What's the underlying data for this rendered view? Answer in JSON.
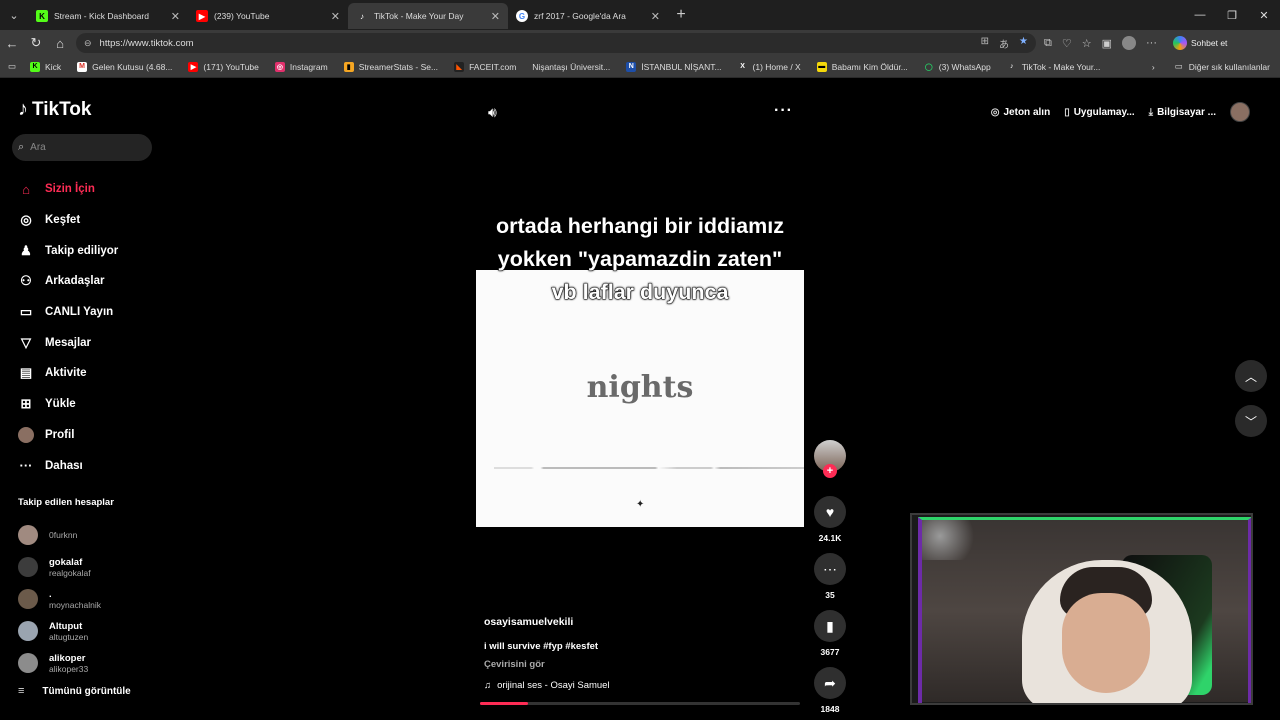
{
  "browser": {
    "tabs": [
      {
        "label": "Stream - Kick Dashboard",
        "icon": "kick-icon",
        "color": "#53fc18",
        "glyph": "K"
      },
      {
        "label": "(239) YouTube",
        "icon": "youtube-icon",
        "color": "#ff0000",
        "glyph": "▶"
      },
      {
        "label": "TikTok - Make Your Day",
        "icon": "tiktok-icon",
        "color": "#000000",
        "glyph": "♪"
      },
      {
        "label": "zrf 2017 - Google'da Ara",
        "icon": "google-icon",
        "color": "#ffffff",
        "glyph": "G"
      }
    ],
    "active_tab": 2,
    "url": "https://www.tiktok.com",
    "copilot_label": "Sohbet et",
    "bookmarks": [
      {
        "label": "Kick",
        "color": "#53fc18",
        "glyph": "K"
      },
      {
        "label": "Gelen Kutusu (4.68...",
        "color": "#ffffff",
        "glyph": "M"
      },
      {
        "label": "(171) YouTube",
        "color": "#ff0000",
        "glyph": "▶"
      },
      {
        "label": "Instagram",
        "color": "#e1306c",
        "glyph": "◎"
      },
      {
        "label": "StreamerStats - Se...",
        "color": "#f5a623",
        "glyph": "▮"
      },
      {
        "label": "FACEIT.com",
        "color": "#ff5500",
        "glyph": "◣"
      },
      {
        "label": "Nişantaşı Üniversit...",
        "color": "#3a3a3a",
        "glyph": ""
      },
      {
        "label": "İSTANBUL NİŞANT...",
        "color": "#1d4ea8",
        "glyph": "N"
      },
      {
        "label": "(1) Home / X",
        "color": "#000000",
        "glyph": "X"
      },
      {
        "label": "Babamı Kim Öldür...",
        "color": "#f5d90a",
        "glyph": "▬"
      },
      {
        "label": "(3) WhatsApp",
        "color": "#25d366",
        "glyph": "◯"
      },
      {
        "label": "TikTok - Make Your...",
        "color": "#000000",
        "glyph": "♪"
      }
    ],
    "bookmarks_other": "Diğer sık kullanılanlar"
  },
  "tiktok": {
    "logo": "TikTok",
    "search_placeholder": "Ara",
    "nav": [
      {
        "label": "Sizin İçin",
        "icon": "home-icon",
        "glyph": "⌂",
        "active": true
      },
      {
        "label": "Keşfet",
        "icon": "compass-icon",
        "glyph": "◎"
      },
      {
        "label": "Takip ediliyor",
        "icon": "following-icon",
        "glyph": "♟"
      },
      {
        "label": "Arkadaşlar",
        "icon": "friends-icon",
        "glyph": "⚇"
      },
      {
        "label": "CANLI Yayın",
        "icon": "live-icon",
        "glyph": "▭"
      },
      {
        "label": "Mesajlar",
        "icon": "messages-icon",
        "glyph": "▽"
      },
      {
        "label": "Aktivite",
        "icon": "activity-icon",
        "glyph": "▤"
      },
      {
        "label": "Yükle",
        "icon": "upload-icon",
        "glyph": "⊞"
      },
      {
        "label": "Profil",
        "icon": "profile-avatar",
        "glyph": ""
      },
      {
        "label": "Dahası",
        "icon": "more-icon",
        "glyph": "···"
      }
    ],
    "following_title": "Takip edilen hesaplar",
    "following": [
      {
        "name": "",
        "handle": "0furknn"
      },
      {
        "name": "gokalaf",
        "handle": "realgokalaf"
      },
      {
        "name": ".",
        "handle": "moynachalnik"
      },
      {
        "name": "Altuput",
        "handle": "altugtuzen"
      },
      {
        "name": "alikoper",
        "handle": "alikoper33"
      }
    ],
    "see_all": "Tümünü görüntüle",
    "top_right": {
      "coins": "Jeton alın",
      "app": "Uygulamay...",
      "pc": "Bilgisayar ..."
    },
    "video": {
      "caption_lines": [
        "ortada herhangi bir iddiamız",
        "yokken \"yapamazdin zaten\"",
        "vb laflar duyunca"
      ],
      "overlay_word": "nights",
      "author": "osayisamuelvekili",
      "description": "i will survive #fyp #kesfet",
      "translate": "Çevirisini gör",
      "music": "orijinal ses - Osayi Samuel",
      "progress": 0.15,
      "likes": "24.1K",
      "comments": "35",
      "saves": "3677",
      "shares": "1848"
    }
  }
}
